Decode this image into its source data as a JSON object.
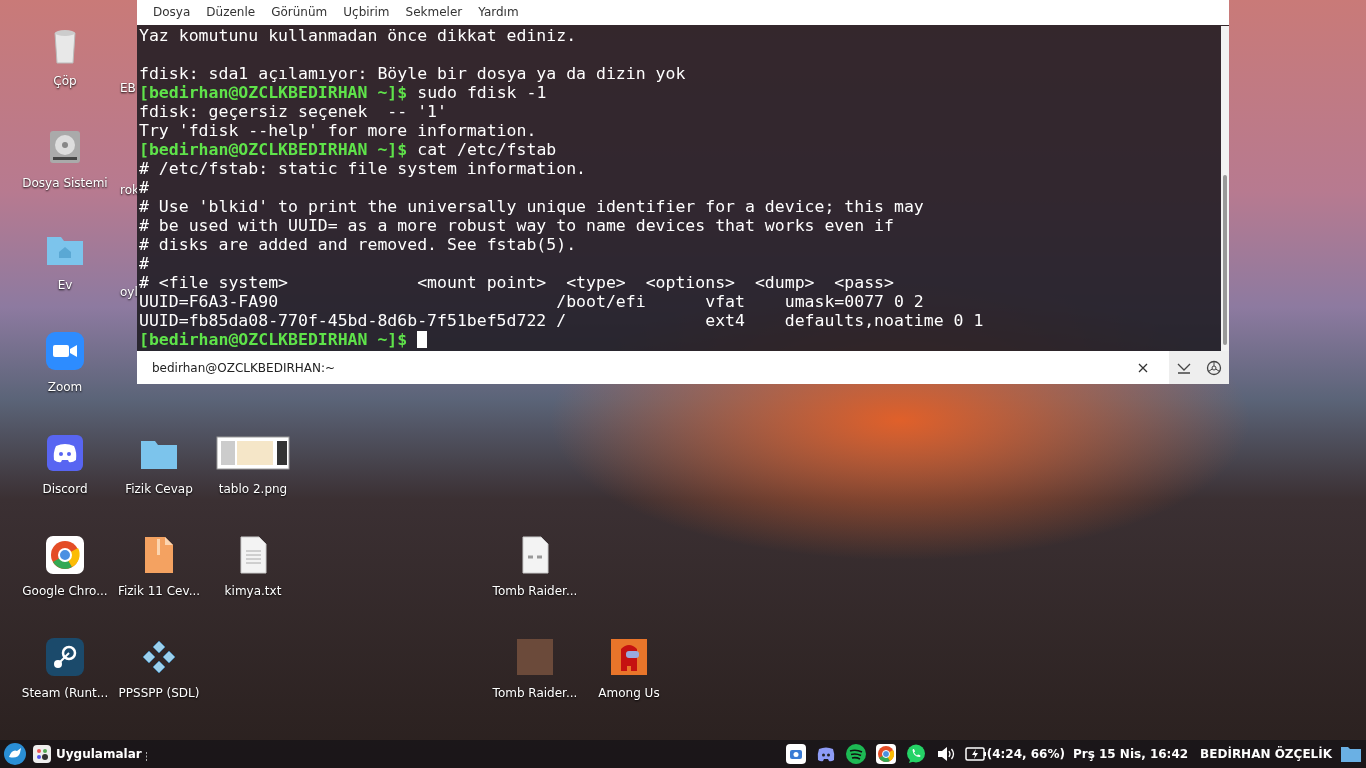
{
  "desktop": {
    "icons": [
      {
        "kind": "trash",
        "label": "Çöp"
      },
      {
        "kind": "drive",
        "label": "Dosya Sistemi"
      },
      {
        "kind": "home",
        "label": "Ev"
      },
      {
        "kind": "zoom",
        "label": "Zoom"
      },
      {
        "kind": "discord",
        "label": "Discord"
      },
      {
        "kind": "chrome",
        "label": "Google Chro..."
      },
      {
        "kind": "steam",
        "label": "Steam (Runt..."
      },
      {
        "kind": "partial",
        "label": "EB"
      },
      {
        "kind": "partial",
        "label": "rok"
      },
      {
        "kind": "partial",
        "label": "oyl"
      },
      {
        "kind": "folder",
        "label": "Fizik Cevap"
      },
      {
        "kind": "archive",
        "label": "Fizik 11 Cev..."
      },
      {
        "kind": "gamepad",
        "label": "PPSSPP (SDL)"
      },
      {
        "kind": "image",
        "label": "tablo 2.png"
      },
      {
        "kind": "text",
        "label": "kimya.txt"
      },
      {
        "kind": "link",
        "label": "Tomb Raider..."
      },
      {
        "kind": "portrait",
        "label": "Tomb Raider..."
      },
      {
        "kind": "among",
        "label": "Among Us"
      }
    ]
  },
  "terminal": {
    "menu": [
      "Dosya",
      "Düzenle",
      "Görünüm",
      "Uçbirim",
      "Sekmeler",
      "Yardım"
    ],
    "lines": [
      {
        "kind": "output",
        "text": "Yaz komutunu kullanmadan önce dikkat ediniz."
      },
      {
        "kind": "blank"
      },
      {
        "kind": "output",
        "text": "fdisk: sda1 açılamıyor: Böyle bir dosya ya da dizin yok"
      },
      {
        "kind": "prompt",
        "prompt": "[bedirhan@OZCLKBEDIRHAN ~]$",
        "command": "sudo fdisk -1"
      },
      {
        "kind": "output",
        "text": "fdisk: geçersiz seçenek  -- '1'"
      },
      {
        "kind": "output",
        "text": "Try 'fdisk --help' for more information."
      },
      {
        "kind": "prompt",
        "prompt": "[bedirhan@OZCLKBEDIRHAN ~]$",
        "command": "cat /etc/fstab"
      },
      {
        "kind": "output",
        "text": "# /etc/fstab: static file system information."
      },
      {
        "kind": "output",
        "text": "#"
      },
      {
        "kind": "output",
        "text": "# Use 'blkid' to print the universally unique identifier for a device; this may"
      },
      {
        "kind": "output",
        "text": "# be used with UUID= as a more robust way to name devices that works even if"
      },
      {
        "kind": "output",
        "text": "# disks are added and removed. See fstab(5)."
      },
      {
        "kind": "output",
        "text": "#"
      },
      {
        "kind": "output",
        "text": "# <file system>             <mount point>  <type>  <options>  <dump>  <pass>"
      },
      {
        "kind": "output",
        "text": "UUID=F6A3-FA90                            /boot/efi      vfat    umask=0077 0 2"
      },
      {
        "kind": "output",
        "text": "UUID=fb85da08-770f-45bd-8d6b-7f51bef5d722 /              ext4    defaults,noatime 0 1"
      },
      {
        "kind": "prompt",
        "prompt": "[bedirhan@OZCLKBEDIRHAN ~]$",
        "cursor": true
      }
    ],
    "tab": {
      "title": "bedirhan@OZCLKBEDIRHAN:~"
    }
  },
  "taskbar": {
    "apps_label": "Uygulamalar",
    "battery_text": "(4:24, 66%)",
    "clock": "Prş 15 Nis, 16:42",
    "user": "BEDİRHAN ÖZÇELİK"
  }
}
